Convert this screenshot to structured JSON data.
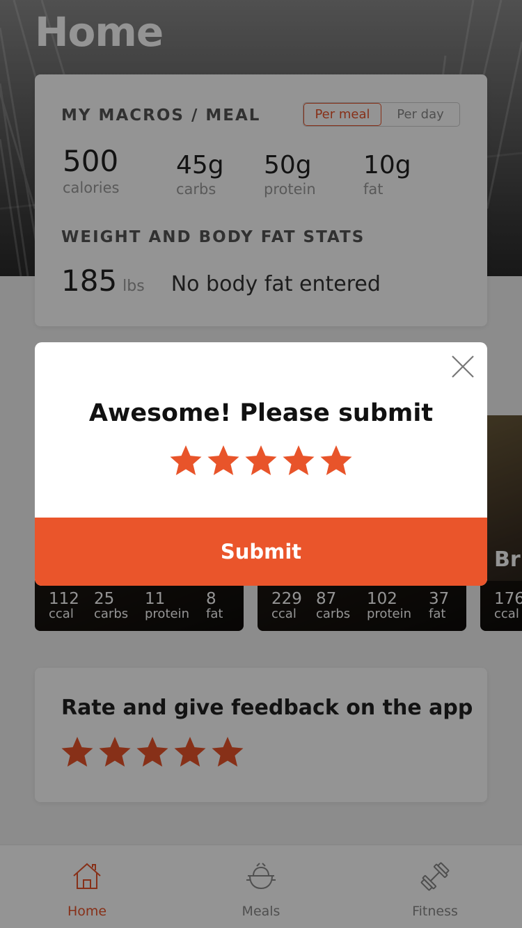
{
  "page": {
    "title": "Home"
  },
  "macros": {
    "heading": "MY MACROS / MEAL",
    "toggle": [
      {
        "label": "Per meal",
        "active": true
      },
      {
        "label": "Per day",
        "active": false
      }
    ],
    "items": [
      {
        "value": "500",
        "unit": "calories"
      },
      {
        "value": "45g",
        "unit": "carbs"
      },
      {
        "value": "50g",
        "unit": "protein"
      },
      {
        "value": "10g",
        "unit": "fat"
      }
    ]
  },
  "stats": {
    "heading": "WEIGHT AND BODY FAT STATS",
    "weight": "185",
    "weight_unit": "lbs",
    "body_fat": "No body fat entered"
  },
  "meals": [
    {
      "ccal": "112",
      "ccal_label": "ccal",
      "carbs": "25",
      "carbs_label": "carbs",
      "protein": "11",
      "protein_label": "protein",
      "fat": "8",
      "fat_label": "fat"
    },
    {
      "ccal": "229",
      "ccal_label": "ccal",
      "carbs": "87",
      "carbs_label": "carbs",
      "protein": "102",
      "protein_label": "protein",
      "fat": "37",
      "fat_label": "fat"
    },
    {
      "title": "Br",
      "ccal": "176",
      "ccal_label": "ccal"
    }
  ],
  "feedback": {
    "title": "Rate and give feedback on the app",
    "rating": 5
  },
  "tabs": [
    {
      "label": "Home",
      "icon": "home-icon",
      "active": true
    },
    {
      "label": "Meals",
      "icon": "meals-icon",
      "active": false
    },
    {
      "label": "Fitness",
      "icon": "dumbbell-icon",
      "active": false
    }
  ],
  "modal": {
    "heading": "Awesome! Please submit",
    "rating": 5,
    "submit_label": "Submit"
  },
  "colors": {
    "accent": "#ea552b",
    "star": "#e8542a"
  }
}
